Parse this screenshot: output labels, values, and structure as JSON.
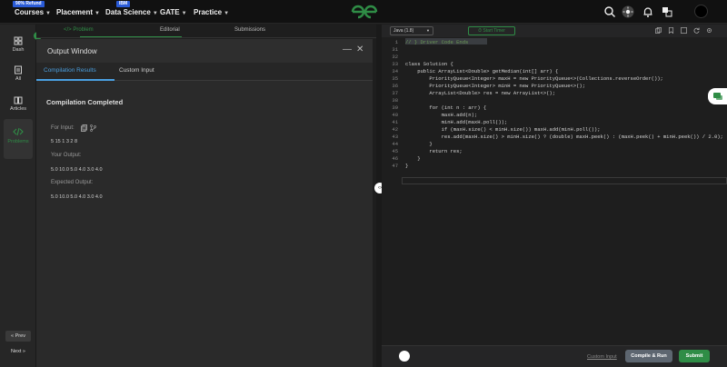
{
  "nav": {
    "items": [
      {
        "label": "Courses",
        "badge": "90% Refund"
      },
      {
        "label": "Placement",
        "badge": ""
      },
      {
        "label": "Data Science",
        "badge": "IBM"
      },
      {
        "label": "GATE",
        "badge": ""
      },
      {
        "label": "Practice",
        "badge": ""
      }
    ],
    "icons": [
      "search-icon",
      "theme-toggle-icon",
      "bell-icon",
      "translate-icon"
    ]
  },
  "sidebar": {
    "items": [
      {
        "label": "Dash",
        "icon": "grid-icon"
      },
      {
        "label": "All",
        "icon": "stack-icon"
      },
      {
        "label": "Articles",
        "icon": "book-icon"
      },
      {
        "label": "Problems",
        "icon": "code-icon"
      }
    ],
    "prev_label": "« Prev",
    "next_label": "Next »"
  },
  "tabs": {
    "problem": "</> Problem",
    "editorial": "Editorial",
    "submissions": "Submissions"
  },
  "output_window": {
    "title": "Output Window",
    "minimize": "—",
    "close": "✕",
    "tab_results": "Compilation Results",
    "tab_custom": "Custom Input",
    "status": "Compilation Completed",
    "input_label": "For Input:",
    "input_value": "5 15 1 3 2 8",
    "your_output_label": "Your Output:",
    "your_output_value": "5.0 10.0 5.0 4.0 3.0 4.0",
    "expected_output_label": "Expected Output:",
    "expected_output_value": "5.0 10.0 5.0 4.0 3.0 4.0"
  },
  "editor": {
    "language": "Java (1.8)",
    "timer_label": "Start Timer",
    "line_numbers": [
      "1",
      "31",
      "32",
      "33",
      "34",
      "35",
      "36",
      "37",
      "38",
      "39",
      "40",
      "41",
      "42",
      "43",
      "44",
      "45",
      "46",
      "47"
    ],
    "lines": [
      "// } Driver Code Ends",
      "",
      "",
      "class Solution {",
      "    public ArrayList<Double> getMedian(int[] arr) {",
      "        PriorityQueue<Integer> maxH = new PriorityQueue<>(Collections.reverseOrder());",
      "        PriorityQueue<Integer> minH = new PriorityQueue<>();",
      "        ArrayList<Double> res = new ArrayList<>();",
      "",
      "        for (int n : arr) {",
      "            maxH.add(n);",
      "            minH.add(maxH.poll());",
      "            if (maxH.size() < minH.size()) maxH.add(minH.poll());",
      "            res.add(maxH.size() > minH.size() ? (double) maxH.peek() : (maxH.peek() + minH.peek()) / 2.0);",
      "        }",
      "        return res;",
      "    }",
      "}"
    ],
    "custom_input_label": "Custom Input",
    "compile_label": "Compile & Run",
    "submit_label": "Submit"
  }
}
